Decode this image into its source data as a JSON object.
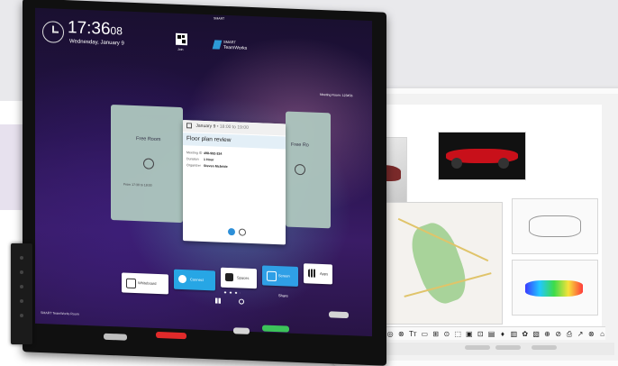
{
  "left_display": {
    "time": "17:36",
    "seconds": "08",
    "date": "Wednesday, January 9",
    "top_center": "SMART",
    "qr_label": "Join",
    "brand": "SMART",
    "brand_sub": "TeamWorks",
    "status_top_right": "Meeting Room: 123456",
    "room_left": "Free Room",
    "room_left_time": "From 17:30 to 18:00",
    "room_right": "Free Ro",
    "meeting": {
      "header": "January 9",
      "header_time": "• 18:00 to 19:00",
      "title": "Floor plan review",
      "rows": [
        {
          "label": "Meeting ID",
          "value": "498-992-324"
        },
        {
          "label": "Duration",
          "value": "1 Hour"
        },
        {
          "label": "Organizer",
          "value": "Steven Mcbride"
        }
      ]
    },
    "apps": [
      {
        "label": "Whiteboard",
        "color": "#ffffff"
      },
      {
        "label": "Connect",
        "color": "#27a6e5"
      },
      {
        "label": "Spaces",
        "color": "#ffffff"
      },
      {
        "label": "Screen Share",
        "color": "#2f9fe6"
      },
      {
        "label": "Apps",
        "color": "#ffffff"
      }
    ],
    "footer_logo": "SMART TeamWorks Room"
  },
  "right_display": {
    "tools": [
      "▢",
      "▦",
      "+",
      "✎",
      "◎",
      "⊗",
      "Tт",
      "▭",
      "⊞",
      "⊙",
      "⬚",
      "▣",
      "⊡",
      "▤",
      "♦",
      "▥",
      "✿",
      "▧",
      "⊕",
      "⊘",
      "⎙",
      "↗",
      "⊗",
      "⌂"
    ]
  },
  "colors": {
    "accent_red": "#e02a2a",
    "accent_green": "#3cc35a",
    "panel_blue": "#2d8fd8",
    "brand_blue": "#2d9ad6"
  }
}
